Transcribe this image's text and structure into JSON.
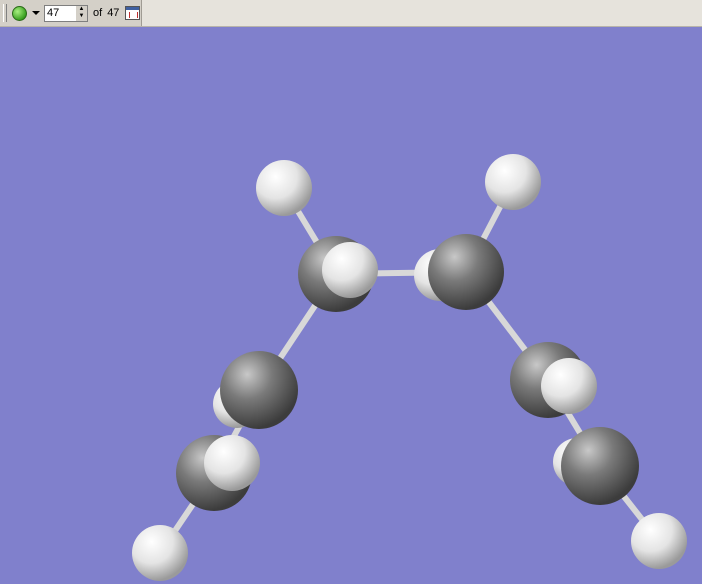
{
  "toolbar": {
    "status_icon": "green-circle",
    "frame_value": "47",
    "of_label": "of",
    "total_frames": "47",
    "calc_icon": "calculator"
  },
  "colors": {
    "background": "#8080cc",
    "carbon": "#6a6a6a",
    "hydrogen": "#f0f0f0"
  }
}
